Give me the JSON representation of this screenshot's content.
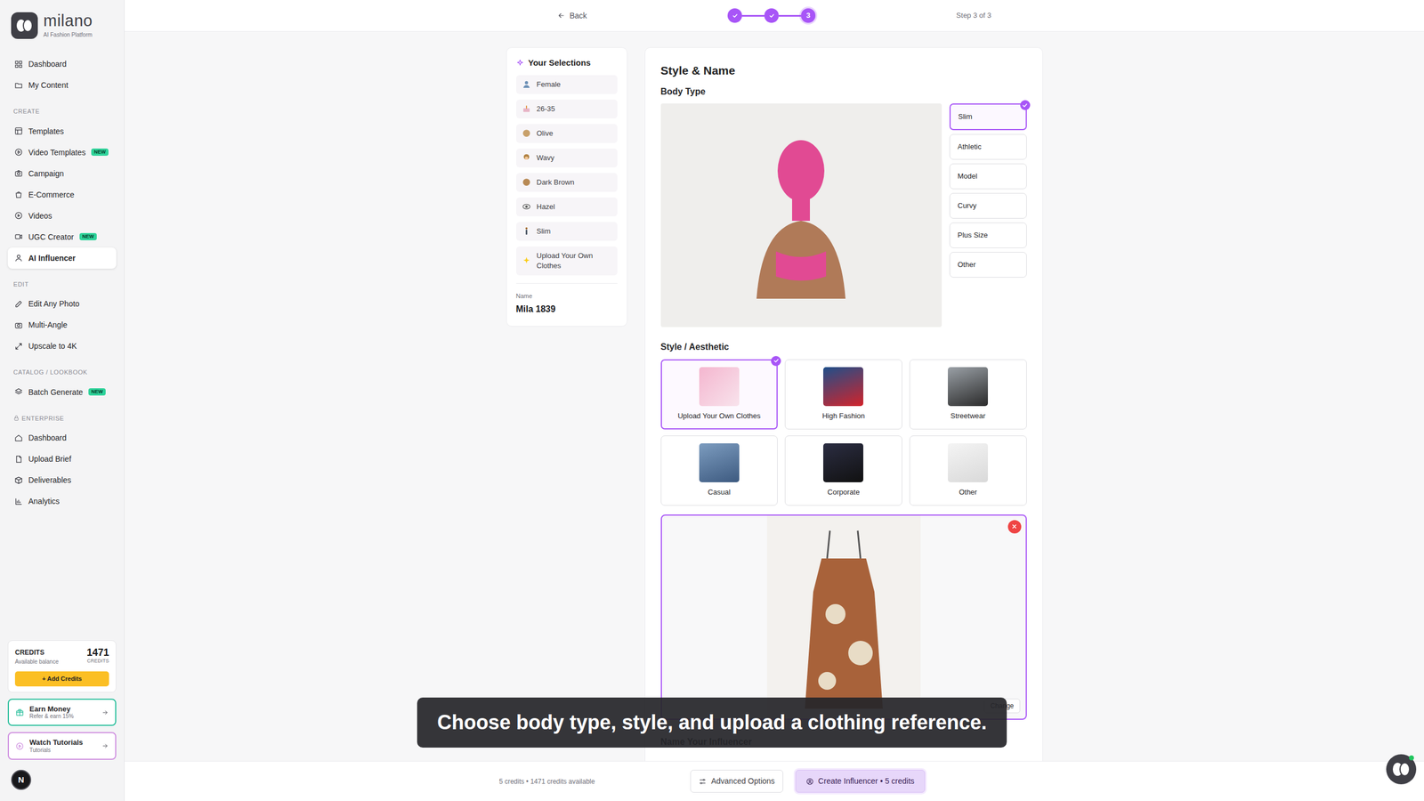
{
  "brand": {
    "name": "milano",
    "tagline": "AI Fashion Platform"
  },
  "sidebar": {
    "groups": [
      {
        "locked": false,
        "items": [
          {
            "label": "Dashboard",
            "selected": false
          },
          {
            "label": "My Content",
            "selected": false
          }
        ]
      },
      {
        "heading": "CREATE",
        "locked": false,
        "items": [
          {
            "label": "Templates",
            "selected": false
          },
          {
            "label": "Video Templates",
            "badge": "NEW",
            "selected": false
          },
          {
            "label": "Campaign",
            "selected": false
          },
          {
            "label": "E-Commerce",
            "selected": false
          },
          {
            "label": "Videos",
            "selected": false
          },
          {
            "label": "UGC Creator",
            "badge": "NEW",
            "selected": false
          },
          {
            "label": "AI Influencer",
            "selected": true
          }
        ]
      },
      {
        "heading": "EDIT",
        "locked": false,
        "items": [
          {
            "label": "Edit Any Photo",
            "selected": false
          },
          {
            "label": "Multi-Angle",
            "selected": false
          },
          {
            "label": "Upscale to 4K",
            "selected": false
          }
        ]
      },
      {
        "heading": "CATALOG / LOOKBOOK",
        "locked": false,
        "items": [
          {
            "label": "Batch Generate",
            "badge": "NEW",
            "selected": false
          }
        ]
      },
      {
        "heading": "ENTERPRISE",
        "locked": true,
        "items": [
          {
            "label": "Dashboard",
            "selected": false
          },
          {
            "label": "Upload Brief",
            "selected": false
          },
          {
            "label": "Deliverables",
            "selected": false
          },
          {
            "label": "Analytics",
            "selected": false
          }
        ]
      }
    ]
  },
  "credits": {
    "title": "CREDITS",
    "subtitle": "Available balance",
    "amount": "1471",
    "unit": "CREDITS",
    "button": "+ Add Credits"
  },
  "promos": [
    {
      "title": "Earn Money",
      "subtitle": "Refer & earn 15%",
      "color": "#2bbf9c"
    },
    {
      "title": "Watch Tutorials",
      "subtitle": "Tutorials",
      "color": "#cf8fe0"
    }
  ],
  "user": {
    "initial": "N"
  },
  "topbar": {
    "back": "Back",
    "steps": [
      {
        "done": true
      },
      {
        "done": true
      },
      {
        "done": false,
        "label": "3"
      }
    ],
    "step_text": "Step 3 of 3"
  },
  "selections": {
    "title": "Your Selections",
    "items": [
      {
        "label": "Female"
      },
      {
        "label": "26-35"
      },
      {
        "label": "Olive"
      },
      {
        "label": "Wavy"
      },
      {
        "label": "Dark Brown"
      },
      {
        "label": "Hazel"
      },
      {
        "label": "Slim"
      },
      {
        "label": "Upload Your Own Clothes"
      }
    ],
    "name_label": "Name",
    "name_value": "Mila 1839"
  },
  "style_form": {
    "title": "Style & Name",
    "body_type": {
      "heading": "Body Type",
      "options": [
        {
          "label": "Slim",
          "selected": true
        },
        {
          "label": "Athletic",
          "selected": false
        },
        {
          "label": "Model",
          "selected": false
        },
        {
          "label": "Curvy",
          "selected": false
        },
        {
          "label": "Plus Size",
          "selected": false
        },
        {
          "label": "Other",
          "selected": false
        }
      ]
    },
    "aesthetic": {
      "heading": "Style / Aesthetic",
      "options": [
        {
          "label": "Upload Your Own Clothes",
          "selected": true
        },
        {
          "label": "High Fashion",
          "selected": false
        },
        {
          "label": "Streetwear",
          "selected": false
        },
        {
          "label": "Casual",
          "selected": false
        },
        {
          "label": "Corporate",
          "selected": false
        },
        {
          "label": "Other",
          "selected": false
        }
      ]
    },
    "upload": {
      "change": "Change"
    },
    "name_heading": "Name Your Influencer"
  },
  "footer": {
    "summary": "5 credits • 1471 credits available",
    "advanced": "Advanced Options",
    "create": "Create Influencer • 5 credits"
  },
  "caption": {
    "text": "Choose body type, style, and upload a clothing reference."
  }
}
